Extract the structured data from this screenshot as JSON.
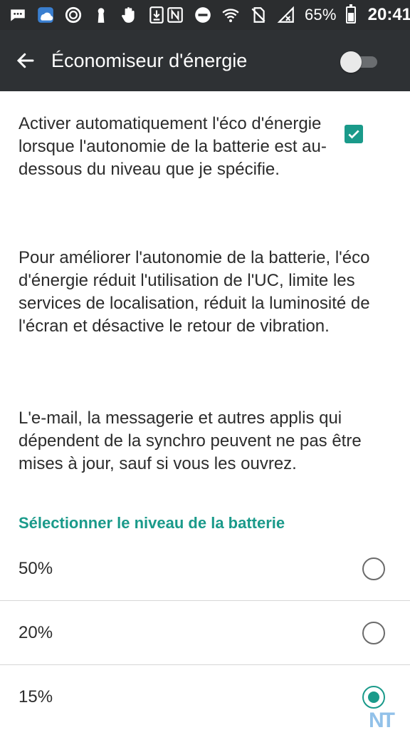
{
  "status_bar": {
    "left_icons": [
      "chat-icon",
      "weather-app-icon",
      "ring-icon",
      "keyhole-icon",
      "hand-icon",
      "download-icon"
    ],
    "right_icons": [
      "nfc-icon",
      "do-not-disturb-icon",
      "wifi-icon",
      "no-sim-icon",
      "no-signal-icon"
    ],
    "battery_percent": "65%",
    "time": "20:41"
  },
  "app_bar": {
    "title": "Économiseur d'énergie",
    "toggle_on": false
  },
  "auto_setting": {
    "text": "Activer automatiquement l'éco d'énergie lorsque l'autonomie de la batterie est au-dessous du niveau que je spécifie.",
    "checked": true
  },
  "description": "Pour améliorer l'autonomie de la batterie, l'éco d'énergie réduit l'utilisation de l'UC, limite les services de localisation, réduit la luminosité de l'écran et désactive le retour de vibration.",
  "sync_note": "L'e-mail, la messagerie et autres applis qui dépendent de la synchro peuvent ne pas être mises à jour, sauf si vous les ouvrez.",
  "battery_section": {
    "header": "Sélectionner le niveau de la batterie",
    "options": [
      {
        "label": "50%",
        "selected": false
      },
      {
        "label": "20%",
        "selected": false
      },
      {
        "label": "15%",
        "selected": true
      }
    ]
  },
  "watermark": "NT",
  "colors": {
    "accent": "#1a9a8a",
    "app_bar": "#2e3134",
    "status_bar": "#2b2d2f"
  }
}
